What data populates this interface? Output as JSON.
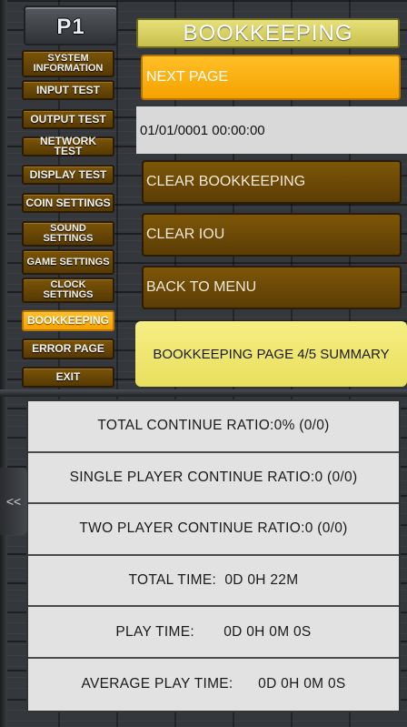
{
  "player_badge": "P1",
  "menu": [
    {
      "label": "SYSTEM INFORMATION",
      "active": false
    },
    {
      "label": "INPUT TEST",
      "active": false
    },
    {
      "label": "OUTPUT TEST",
      "active": false
    },
    {
      "label": "NETWORK TEST",
      "active": false
    },
    {
      "label": "DISPLAY TEST",
      "active": false
    },
    {
      "label": "COIN SETTINGS",
      "active": false
    },
    {
      "label": "SOUND SETTINGS",
      "active": false
    },
    {
      "label": "GAME SETTINGS",
      "active": false
    },
    {
      "label": "CLOCK SETTINGS",
      "active": false
    },
    {
      "label": "BOOKKEEPING",
      "active": true
    },
    {
      "label": "ERROR PAGE",
      "active": false
    },
    {
      "label": "EXIT",
      "active": false
    }
  ],
  "header": {
    "title": "BOOKKEEPING"
  },
  "actions": {
    "next_page": "NEXT PAGE",
    "datetime": "01/01/0001 00:00:00",
    "clear_bookkeeping": "CLEAR BOOKKEEPING",
    "clear_iou": "CLEAR IOU",
    "back_to_menu": "BACK TO MENU"
  },
  "summary": "BOOKKEEPING PAGE 4/5 SUMMARY",
  "stats": [
    "TOTAL CONTINUE RATIO:0% (0/0)",
    "SINGLE PLAYER CONTINUE RATIO:0 (0/0)",
    "TWO PLAYER CONTINUE RATIO:0 (0/0)",
    "TOTAL TIME:  0D 0H 22M",
    "PLAY TIME:       0D 0H 0M 0S",
    "AVERAGE PLAY TIME:      0D 0H 0M 0S"
  ],
  "handle_glyph": "<<",
  "colors": {
    "accent_orange": "#f5a300",
    "menu_brown": "#6a4806",
    "title_yellow": "#d8d05e",
    "summary_yellow": "#f0e672",
    "stats_bg": "#e2e2e2"
  }
}
